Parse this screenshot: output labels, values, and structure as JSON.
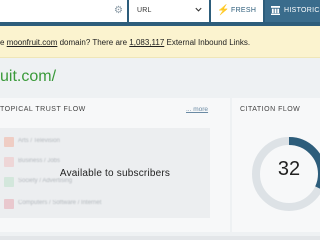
{
  "toolbar": {
    "url_select": "URL",
    "fresh_label": "FRESH",
    "historic_label": "HISTORIC",
    "icons": [
      "gear-icon",
      "chevron-down-icon",
      "bolt-icon",
      "columns-icon"
    ]
  },
  "notice": {
    "prefix": "e ",
    "domain_link": "moonfruit.com",
    "middle": " domain? There are ",
    "count": "1,083,117",
    "suffix": " External Inbound Links."
  },
  "domain_title": "uit.com/",
  "topical_trust_flow": {
    "title": "TOPICAL TRUST FLOW",
    "more": "... more",
    "overlay": "Available to subscribers",
    "categories": [
      {
        "label": "Arts / Television",
        "color": "#f3a58d"
      },
      {
        "label": "Business / Jobs",
        "color": "#f2b8b8"
      },
      {
        "label": "Society / Advertising",
        "color": "#b5dec4"
      },
      {
        "label": "Computers / Software / Internet",
        "color": "#e79aa5"
      }
    ]
  },
  "citation_flow": {
    "title": "CITATION FLOW",
    "value": "32",
    "max": 100,
    "ring_color": "#2d5d7b",
    "track_color": "#dde2e6"
  }
}
